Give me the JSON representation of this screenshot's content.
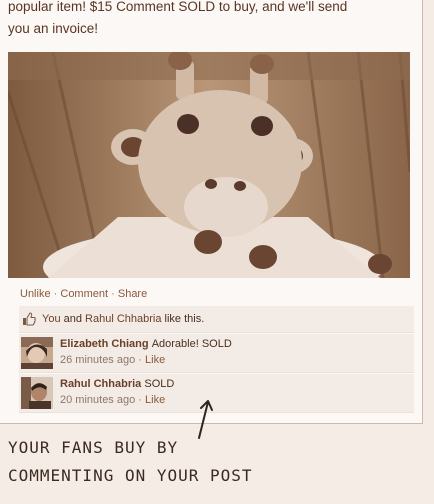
{
  "post": {
    "text_line1": "popular item! $15 Comment SOLD to buy, and we'll send",
    "text_line2": "you an invoice!"
  },
  "photo": {
    "icon": "crochet-giraffe-photo"
  },
  "actions": {
    "unlike": "Unlike",
    "comment": "Comment",
    "share": "Share",
    "separator": "·"
  },
  "likes": {
    "user1": "You",
    "conjunction": "and",
    "user2": "Rahul Chhabria",
    "suffix": "like this.",
    "icon": "thumbs-up-icon"
  },
  "comments": [
    {
      "author": "Elizabeth Chiang",
      "text": "Adorable! SOLD",
      "time": "26 minutes ago",
      "like": "Like",
      "separator": "·"
    },
    {
      "author": "Rahul Chhabria",
      "text": "SOLD",
      "time": "20 minutes ago",
      "like": "Like",
      "separator": "·"
    }
  ],
  "annotation": {
    "line1": "YOUR FANS BUY BY",
    "line2": "COMMENTING ON YOUR POST"
  },
  "colors": {
    "link": "#6b3f27",
    "text": "#4a2e1e",
    "background": "#f6ece6"
  }
}
